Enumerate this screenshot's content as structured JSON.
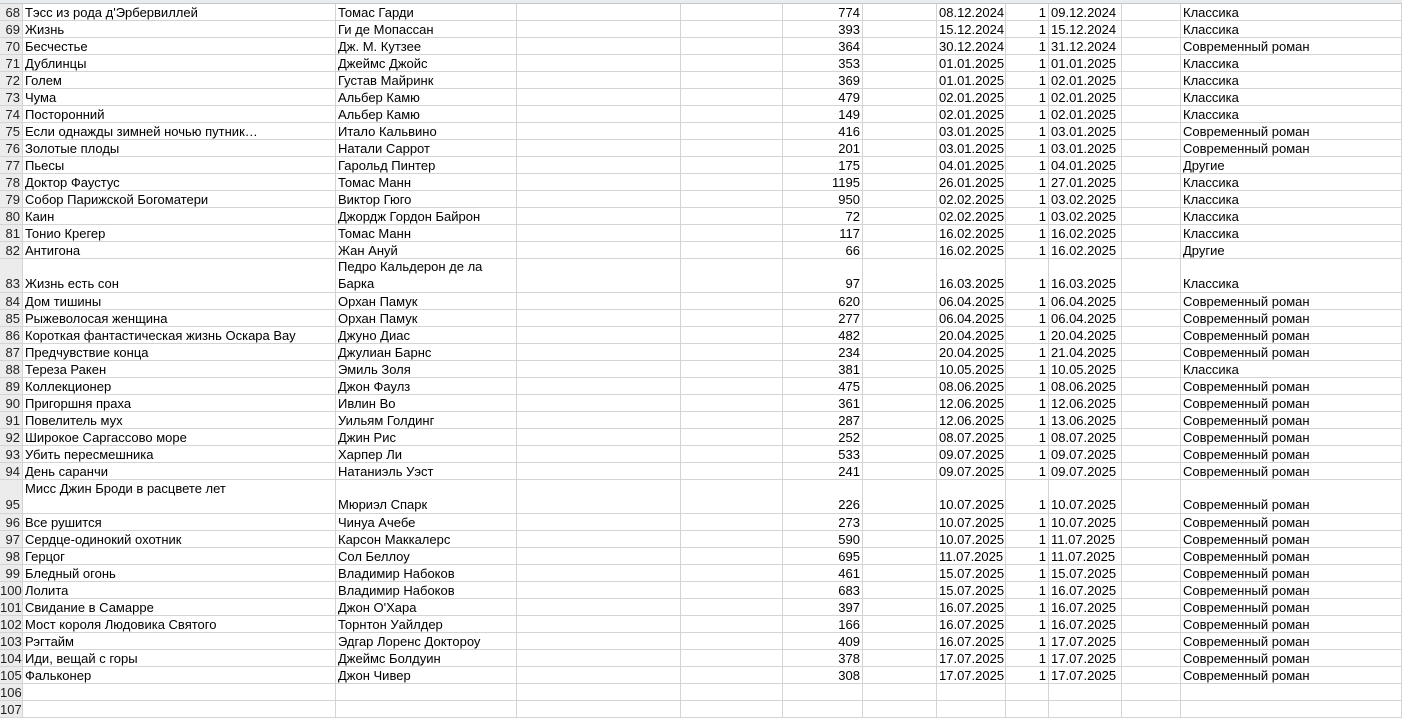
{
  "rows": [
    {
      "n": "68",
      "title": "Тэсс из рода д'Эрбервиллей",
      "author": "Томас Гарди",
      "pages": "774",
      "start": "08.12.2024",
      "count": "1",
      "end": "09.12.2024",
      "genre": "Классика"
    },
    {
      "n": "69",
      "title": "Жизнь",
      "author": "Ги де Мопассан",
      "pages": "393",
      "start": "15.12.2024",
      "count": "1",
      "end": "15.12.2024",
      "genre": "Классика"
    },
    {
      "n": "70",
      "title": "Бесчестье",
      "author": "Дж. М. Кутзее",
      "pages": "364",
      "start": "30.12.2024",
      "count": "1",
      "end": "31.12.2024",
      "genre": "Современный роман"
    },
    {
      "n": "71",
      "title": "Дублинцы",
      "author": "Джеймс Джойс",
      "pages": "353",
      "start": "01.01.2025",
      "count": "1",
      "end": "01.01.2025",
      "genre": "Классика"
    },
    {
      "n": "72",
      "title": "Голем",
      "author": "Густав Майринк",
      "pages": "369",
      "start": "01.01.2025",
      "count": "1",
      "end": "02.01.2025",
      "genre": "Классика"
    },
    {
      "n": "73",
      "title": "Чума",
      "author": "Альбер Камю",
      "pages": "479",
      "start": "02.01.2025",
      "count": "1",
      "end": "02.01.2025",
      "genre": "Классика"
    },
    {
      "n": "74",
      "title": "Посторонний",
      "author": "Альбер Камю",
      "pages": "149",
      "start": "02.01.2025",
      "count": "1",
      "end": "02.01.2025",
      "genre": "Классика"
    },
    {
      "n": "75",
      "title": "Если однажды зимней ночью путник…",
      "author": "Итало Кальвино",
      "pages": "416",
      "start": "03.01.2025",
      "count": "1",
      "end": "03.01.2025",
      "genre": "Современный роман"
    },
    {
      "n": "76",
      "title": "Золотые плоды",
      "author": "Натали Саррот",
      "pages": "201",
      "start": "03.01.2025",
      "count": "1",
      "end": "03.01.2025",
      "genre": "Современный роман"
    },
    {
      "n": "77",
      "title": "Пьесы",
      "author": "Гарольд Пинтер",
      "pages": "175",
      "start": "04.01.2025",
      "count": "1",
      "end": "04.01.2025",
      "genre": "Другие"
    },
    {
      "n": "78",
      "title": "Доктор Фаустус",
      "author": "Томас Манн",
      "pages": "1195",
      "start": "26.01.2025",
      "count": "1",
      "end": "27.01.2025",
      "genre": "Классика"
    },
    {
      "n": "79",
      "title": "Собор Парижской Богоматери",
      "author": "Виктор Гюго",
      "pages": "950",
      "start": "02.02.2025",
      "count": "1",
      "end": "03.02.2025",
      "genre": "Классика"
    },
    {
      "n": "80",
      "title": "Каин",
      "author": "Джордж Гордон Байрон",
      "pages": "72",
      "start": "02.02.2025",
      "count": "1",
      "end": "03.02.2025",
      "genre": "Классика"
    },
    {
      "n": "81",
      "title": "Тонио Крегер",
      "author": "Томас Манн",
      "pages": "117",
      "start": "16.02.2025",
      "count": "1",
      "end": "16.02.2025",
      "genre": "Классика"
    },
    {
      "n": "82",
      "title": "Антигона",
      "author": "Жан Ануй",
      "pages": "66",
      "start": "16.02.2025",
      "count": "1",
      "end": "16.02.2025",
      "genre": "Другие"
    },
    {
      "n": "83",
      "title": "Жизнь есть сон",
      "author": "Педро Кальдерон де ла Барка",
      "pages": "97",
      "start": "16.03.2025",
      "count": "1",
      "end": "16.03.2025",
      "genre": "Классика",
      "tall": "author"
    },
    {
      "n": "84",
      "title": "Дом тишины",
      "author": "Орхан Памук",
      "pages": "620",
      "start": "06.04.2025",
      "count": "1",
      "end": "06.04.2025",
      "genre": "Современный роман"
    },
    {
      "n": "85",
      "title": "Рыжеволосая женщина",
      "author": "Орхан Памук",
      "pages": "277",
      "start": "06.04.2025",
      "count": "1",
      "end": "06.04.2025",
      "genre": "Современный роман"
    },
    {
      "n": "86",
      "title": "Короткая фантастическая жизнь Оскара Вау",
      "author": "Джуно Диас",
      "pages": "482",
      "start": "20.04.2025",
      "count": "1",
      "end": "20.04.2025",
      "genre": "Современный роман"
    },
    {
      "n": "87",
      "title": "Предчувствие конца",
      "author": "Джулиан Барнс",
      "pages": "234",
      "start": "20.04.2025",
      "count": "1",
      "end": "21.04.2025",
      "genre": "Современный роман"
    },
    {
      "n": "88",
      "title": "Тереза Ракен",
      "author": "Эмиль Золя",
      "pages": "381",
      "start": "10.05.2025",
      "count": "1",
      "end": "10.05.2025",
      "genre": "Классика"
    },
    {
      "n": "89",
      "title": "Коллекционер",
      "author": "Джон Фаулз",
      "pages": "475",
      "start": "08.06.2025",
      "count": "1",
      "end": "08.06.2025",
      "genre": "Современный роман"
    },
    {
      "n": "90",
      "title": "Пригоршня праха",
      "author": "Ивлин Во",
      "pages": "361",
      "start": "12.06.2025",
      "count": "1",
      "end": "12.06.2025",
      "genre": "Современный роман"
    },
    {
      "n": "91",
      "title": "Повелитель мух",
      "author": "Уильям Голдинг",
      "pages": "287",
      "start": "12.06.2025",
      "count": "1",
      "end": "13.06.2025",
      "genre": "Современный роман"
    },
    {
      "n": "92",
      "title": "Широкое Саргассово море",
      "author": "Джин Рис",
      "pages": "252",
      "start": "08.07.2025",
      "count": "1",
      "end": "08.07.2025",
      "genre": "Современный роман"
    },
    {
      "n": "93",
      "title": "Убить пересмешника",
      "author": "Харпер Ли",
      "pages": "533",
      "start": "09.07.2025",
      "count": "1",
      "end": "09.07.2025",
      "genre": "Современный роман"
    },
    {
      "n": "94",
      "title": "День саранчи",
      "author": "Натаниэль Уэст",
      "pages": "241",
      "start": "09.07.2025",
      "count": "1",
      "end": "09.07.2025",
      "genre": "Современный роман"
    },
    {
      "n": "95",
      "title": "Мисс Джин Броди в расцвете лет",
      "author": "Мюриэл Спарк",
      "pages": "226",
      "start": "10.07.2025",
      "count": "1",
      "end": "10.07.2025",
      "genre": "Современный роман",
      "tall": "title"
    },
    {
      "n": "96",
      "title": "Все рушится",
      "author": "Чинуа Ачебе",
      "pages": "273",
      "start": "10.07.2025",
      "count": "1",
      "end": "10.07.2025",
      "genre": "Современный роман"
    },
    {
      "n": "97",
      "title": "Сердце-одинокий охотник",
      "author": "Карсон Маккалерс",
      "pages": "590",
      "start": "10.07.2025",
      "count": "1",
      "end": "11.07.2025",
      "genre": "Современный роман"
    },
    {
      "n": "98",
      "title": "Герцог",
      "author": "Сол Беллоу",
      "pages": "695",
      "start": "11.07.2025",
      "count": "1",
      "end": "11.07.2025",
      "genre": "Современный роман"
    },
    {
      "n": "99",
      "title": "Бледный огонь",
      "author": "Владимир Набоков",
      "pages": "461",
      "start": "15.07.2025",
      "count": "1",
      "end": "15.07.2025",
      "genre": "Современный роман"
    },
    {
      "n": "100",
      "title": "Лолита",
      "author": "Владимир Набоков",
      "pages": "683",
      "start": "15.07.2025",
      "count": "1",
      "end": "16.07.2025",
      "genre": "Современный роман"
    },
    {
      "n": "101",
      "title": "Свидание в Самарре",
      "author": "Джон О'Хара",
      "pages": "397",
      "start": "16.07.2025",
      "count": "1",
      "end": "16.07.2025",
      "genre": "Современный роман"
    },
    {
      "n": "102",
      "title": "Мост короля Людовика Святого",
      "author": "Торнтон Уайлдер",
      "pages": "166",
      "start": "16.07.2025",
      "count": "1",
      "end": "16.07.2025",
      "genre": "Современный роман"
    },
    {
      "n": "103",
      "title": "Рэгтайм",
      "author": "Эдгар Лоренс Доктороу",
      "pages": "409",
      "start": "16.07.2025",
      "count": "1",
      "end": "17.07.2025",
      "genre": "Современный роман"
    },
    {
      "n": "104",
      "title": "Иди, вещай с горы",
      "author": "Джеймс Болдуин",
      "pages": "378",
      "start": "17.07.2025",
      "count": "1",
      "end": "17.07.2025",
      "genre": "Современный роман"
    },
    {
      "n": "105",
      "title": "Фальконер",
      "author": "Джон Чивер",
      "pages": "308",
      "start": "17.07.2025",
      "count": "1",
      "end": "17.07.2025",
      "genre": "Современный роман"
    },
    {
      "n": "106",
      "title": "",
      "author": "",
      "pages": "",
      "start": "",
      "count": "",
      "end": "",
      "genre": ""
    },
    {
      "n": "107",
      "title": "",
      "author": "",
      "pages": "",
      "start": "",
      "count": "",
      "end": "",
      "genre": ""
    }
  ]
}
